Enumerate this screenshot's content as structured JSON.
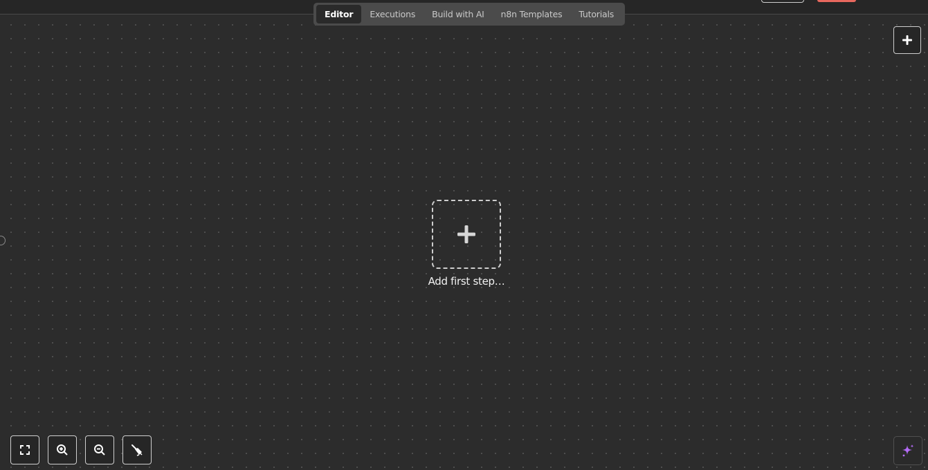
{
  "tabs": [
    {
      "label": "Editor",
      "active": true
    },
    {
      "label": "Executions",
      "active": false
    },
    {
      "label": "Build with AI",
      "active": false
    },
    {
      "label": "n8n Templates",
      "active": false
    },
    {
      "label": "Tutorials",
      "active": false
    }
  ],
  "canvas": {
    "add_first_step_label": "Add first step…"
  },
  "toolbar": {
    "zoom_to_fit_icon": "expand-icon",
    "zoom_in_icon": "zoom-in-icon",
    "zoom_out_icon": "zoom-out-icon",
    "tidy_up_icon": "broom-icon"
  },
  "colors": {
    "canvas_bg": "#2c2c2c",
    "accent_red": "#e8685e",
    "ai_sparkle": "#b36bf5"
  }
}
